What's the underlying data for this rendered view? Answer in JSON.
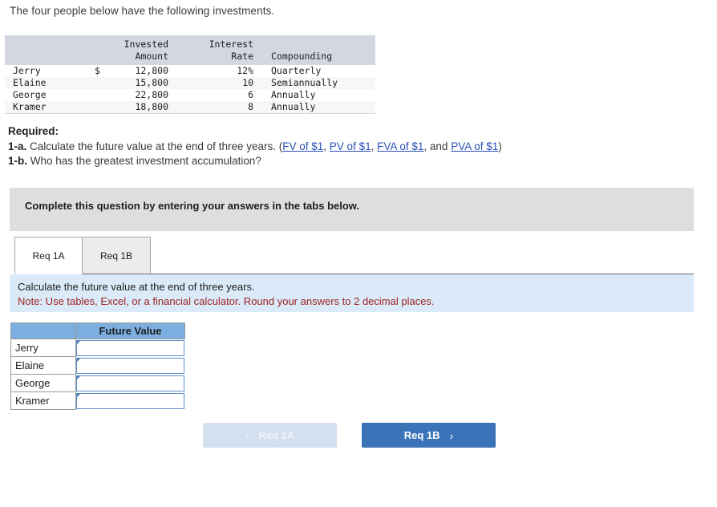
{
  "intro": {
    "text": "The four people below have the following investments."
  },
  "data_table": {
    "headers": {
      "name": "",
      "invested_amount_l1": "Invested",
      "invested_amount_l2": "Amount",
      "interest_rate_l1": "Interest",
      "interest_rate_l2": "Rate",
      "compounding": "Compounding"
    },
    "rows": [
      {
        "name": "Jerry",
        "currency": "$",
        "amount": "12,800",
        "rate": "12%",
        "compounding": "Quarterly"
      },
      {
        "name": "Elaine",
        "currency": "",
        "amount": "15,800",
        "rate": "10",
        "compounding": "Semiannually"
      },
      {
        "name": "George",
        "currency": "",
        "amount": "22,800",
        "rate": "6",
        "compounding": "Annually"
      },
      {
        "name": "Kramer",
        "currency": "",
        "amount": "18,800",
        "rate": "8",
        "compounding": "Annually"
      }
    ]
  },
  "required": {
    "heading": "Required:",
    "item_a_label": "1-a.",
    "item_a_text": "Calculate the future value at the end of three years.",
    "paren_open": "(",
    "links": [
      {
        "label": "FV of $1",
        "sep": ", "
      },
      {
        "label": "PV of $1",
        "sep": ", "
      },
      {
        "label": "FVA of $1",
        "sep": ", and "
      },
      {
        "label": "PVA of $1",
        "sep": ""
      }
    ],
    "paren_close": ")",
    "item_b_label": "1-b.",
    "item_b_text": "Who has the greatest investment accumulation?"
  },
  "banner": {
    "text": "Complete this question by entering your answers in the tabs below."
  },
  "tabs": [
    {
      "label": "Req 1A",
      "active": true
    },
    {
      "label": "Req 1B",
      "active": false
    }
  ],
  "instruction_panel": {
    "line1": "Calculate the future value at the end of three years.",
    "line2": "Note: Use tables, Excel, or a financial calculator. Round your answers to 2 decimal places."
  },
  "answer_table": {
    "corner_header": "",
    "value_header": "Future Value",
    "rows": [
      {
        "label": "Jerry",
        "value": ""
      },
      {
        "label": "Elaine",
        "value": ""
      },
      {
        "label": "George",
        "value": ""
      },
      {
        "label": "Kramer",
        "value": ""
      }
    ]
  },
  "nav": {
    "prev_label": "Req 1A",
    "prev_chevron": "‹",
    "next_label": "Req 1B",
    "next_chevron": "›"
  },
  "colors": {
    "banner_gray": "#dedede",
    "panel_blue": "#daeaf8",
    "table_header_blue": "#7cafe0",
    "data_header_gray": "#d2d7e2",
    "btn_active_blue": "#3b73b9",
    "btn_disabled_blue": "#d4e0ef",
    "note_red": "#9e2222",
    "link_blue": "#2a4fb7"
  }
}
